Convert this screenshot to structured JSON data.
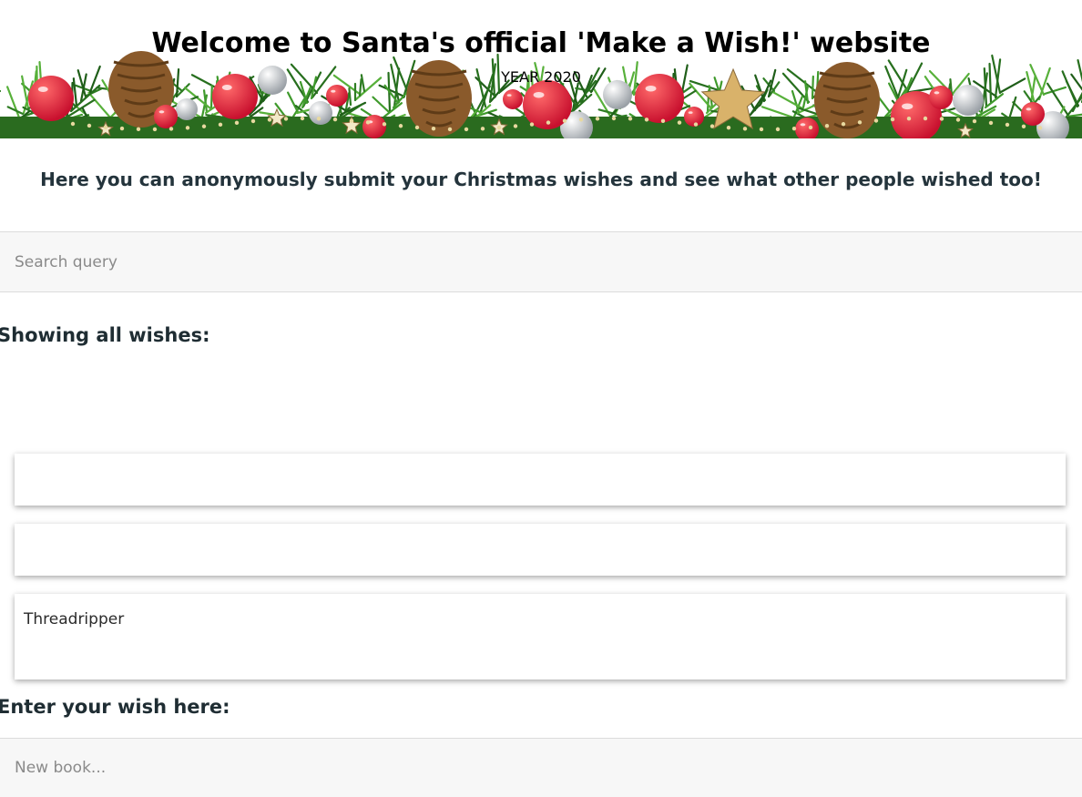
{
  "header": {
    "title": "Welcome to Santa's official 'Make a Wish!' website",
    "year": "YEAR 2020"
  },
  "intro": "Here you can anonymously submit your Christmas wishes and see what other people wished too!",
  "search": {
    "placeholder": "Search query",
    "value": ""
  },
  "wishes_heading": "Showing all wishes:",
  "wishes": [
    "",
    "",
    "Threadripper"
  ],
  "entry": {
    "heading": "Enter your wish here:",
    "placeholder": "New book...",
    "value": ""
  },
  "colors": {
    "ornament_red": "#c8102e",
    "ornament_silver": "#c9cdd2",
    "pine_green": "#2f7d24",
    "pinecone_brown": "#8a5a2b",
    "star_gold": "#d9b26a"
  }
}
